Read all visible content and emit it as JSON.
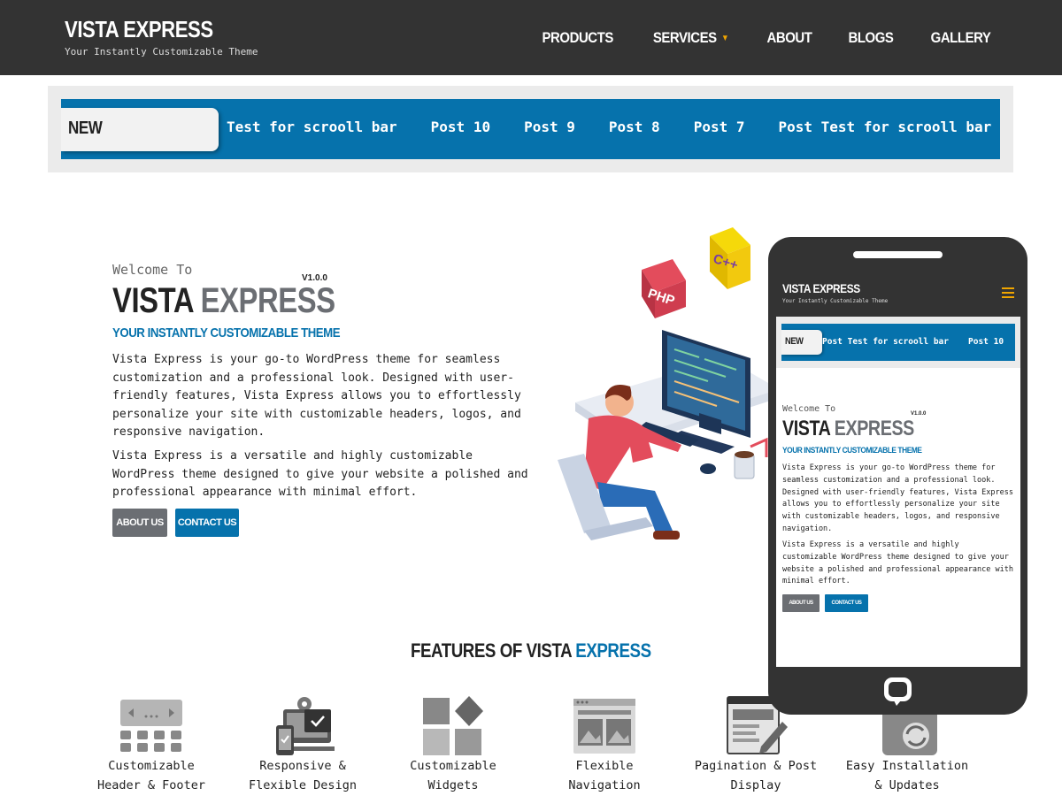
{
  "header": {
    "title": "VISTA EXPRESS",
    "tagline": "Your Instantly Customizable Theme",
    "nav": [
      {
        "label": "PRODUCTS"
      },
      {
        "label": "SERVICES",
        "has_dropdown": true
      },
      {
        "label": "ABOUT"
      },
      {
        "label": "BLOGS"
      },
      {
        "label": "GALLERY"
      }
    ]
  },
  "ticker": {
    "badge": "NEW",
    "items": [
      "Test for scrooll bar",
      "Post 10",
      "Post 9",
      "Post 8",
      "Post 7",
      "Post Test for scrooll bar"
    ]
  },
  "hero": {
    "welcome": "Welcome To",
    "title_main": "VISTA",
    "title_accent": "EXPRESS",
    "version": "V1.0.0",
    "subtitle": "YOUR INSTANTLY CUSTOMIZABLE THEME",
    "paragraph1": "Vista Express is your go-to WordPress theme for seamless customization and a professional look. Designed with user-friendly features, Vista Express allows you to effortlessly personalize your site with customizable headers, logos, and responsive navigation.",
    "paragraph2": "Vista Express is a versatile and highly customizable WordPress theme designed to give your website a polished and professional appearance with minimal effort.",
    "about_button": "ABOUT US",
    "contact_button": "CONTACT US"
  },
  "illustration": {
    "php_label": "PHP",
    "cpp_label": "C++"
  },
  "features": {
    "title_main": "FEATURES OF VISTA",
    "title_accent": "EXPRESS",
    "items": [
      {
        "label": "Customizable\nHeader & Footer",
        "icon": "header-footer-icon"
      },
      {
        "label": "Responsive &\nFlexible Design",
        "icon": "responsive-icon"
      },
      {
        "label": "Customizable\nWidgets",
        "icon": "widgets-icon"
      },
      {
        "label": "Flexible\nNavigation",
        "icon": "navigation-icon"
      },
      {
        "label": "Pagination & Post\nDisplay",
        "icon": "pagination-icon"
      },
      {
        "label": "Easy Installation\n& Updates",
        "icon": "installation-icon"
      }
    ]
  },
  "phone": {
    "title": "VISTA EXPRESS",
    "tagline": "Your Instantly Customizable Theme",
    "ticker_badge": "NEW",
    "ticker_items": [
      "Post Test for scrooll bar",
      "Post 10"
    ],
    "welcome": "Welcome To",
    "title_main": "VISTA",
    "title_accent": "EXPRESS",
    "version": "V1.0.0",
    "subtitle": "YOUR INSTANTLY CUSTOMIZABLE THEME",
    "paragraph1": "Vista Express is your go-to WordPress theme for seamless customization and a professional look. Designed with user-friendly features, Vista Express allows you to effortlessly personalize your site with customizable headers, logos, and responsive navigation.",
    "paragraph2": "Vista Express is a versatile and highly customizable WordPress theme designed to give your website a polished and professional appearance with minimal effort.",
    "about_button": "ABOUT US",
    "contact_button": "CONTACT US"
  },
  "colors": {
    "header_bg": "#333333",
    "accent_blue": "#0672ac",
    "accent_gray": "#6b6e73",
    "caret": "#f0a500"
  }
}
